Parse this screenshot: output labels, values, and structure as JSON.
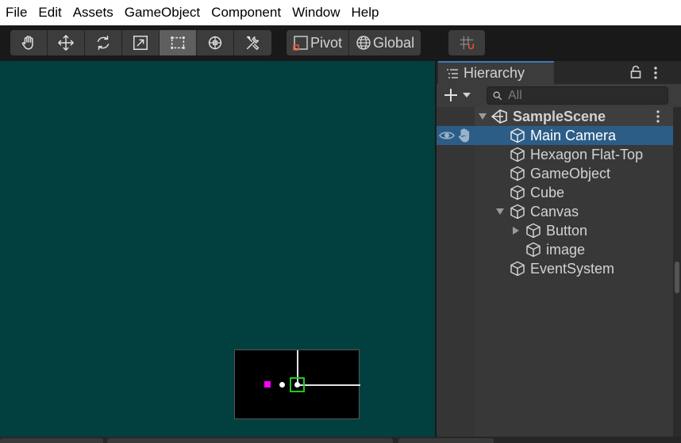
{
  "menu": [
    "File",
    "Edit",
    "Assets",
    "GameObject",
    "Component",
    "Window",
    "Help"
  ],
  "toolbar": {
    "tools": [
      {
        "name": "hand-tool",
        "icon": "hand-icon",
        "active": false
      },
      {
        "name": "move-tool",
        "icon": "move-icon",
        "active": false
      },
      {
        "name": "rotate-tool",
        "icon": "rotate-icon",
        "active": false
      },
      {
        "name": "scale-tool",
        "icon": "scale-icon",
        "active": false
      },
      {
        "name": "rect-tool",
        "icon": "rect-icon",
        "active": true
      },
      {
        "name": "transform-tool",
        "icon": "transform-icon",
        "active": false
      },
      {
        "name": "custom-tool",
        "icon": "tools-icon",
        "active": false
      }
    ],
    "pivot_label": "Pivot",
    "global_label": "Global"
  },
  "hierarchy": {
    "tab_label": "Hierarchy",
    "search_placeholder": "All",
    "scene_name": "SampleScene",
    "items": [
      {
        "label": "Main Camera",
        "selected": true
      },
      {
        "label": "Hexagon Flat-Top",
        "selected": false
      },
      {
        "label": "GameObject",
        "selected": false
      },
      {
        "label": "Cube",
        "selected": false
      },
      {
        "label": "Canvas",
        "selected": false
      },
      {
        "label": "Button",
        "selected": false
      },
      {
        "label": "image",
        "selected": false
      },
      {
        "label": "EventSystem",
        "selected": false
      }
    ]
  },
  "colors": {
    "scene_background": "#024040",
    "selection": "#2c5d87",
    "tab_accent": "#3a79bb",
    "preview_marker": "#ff00ff",
    "preview_selection": "#22c822"
  }
}
